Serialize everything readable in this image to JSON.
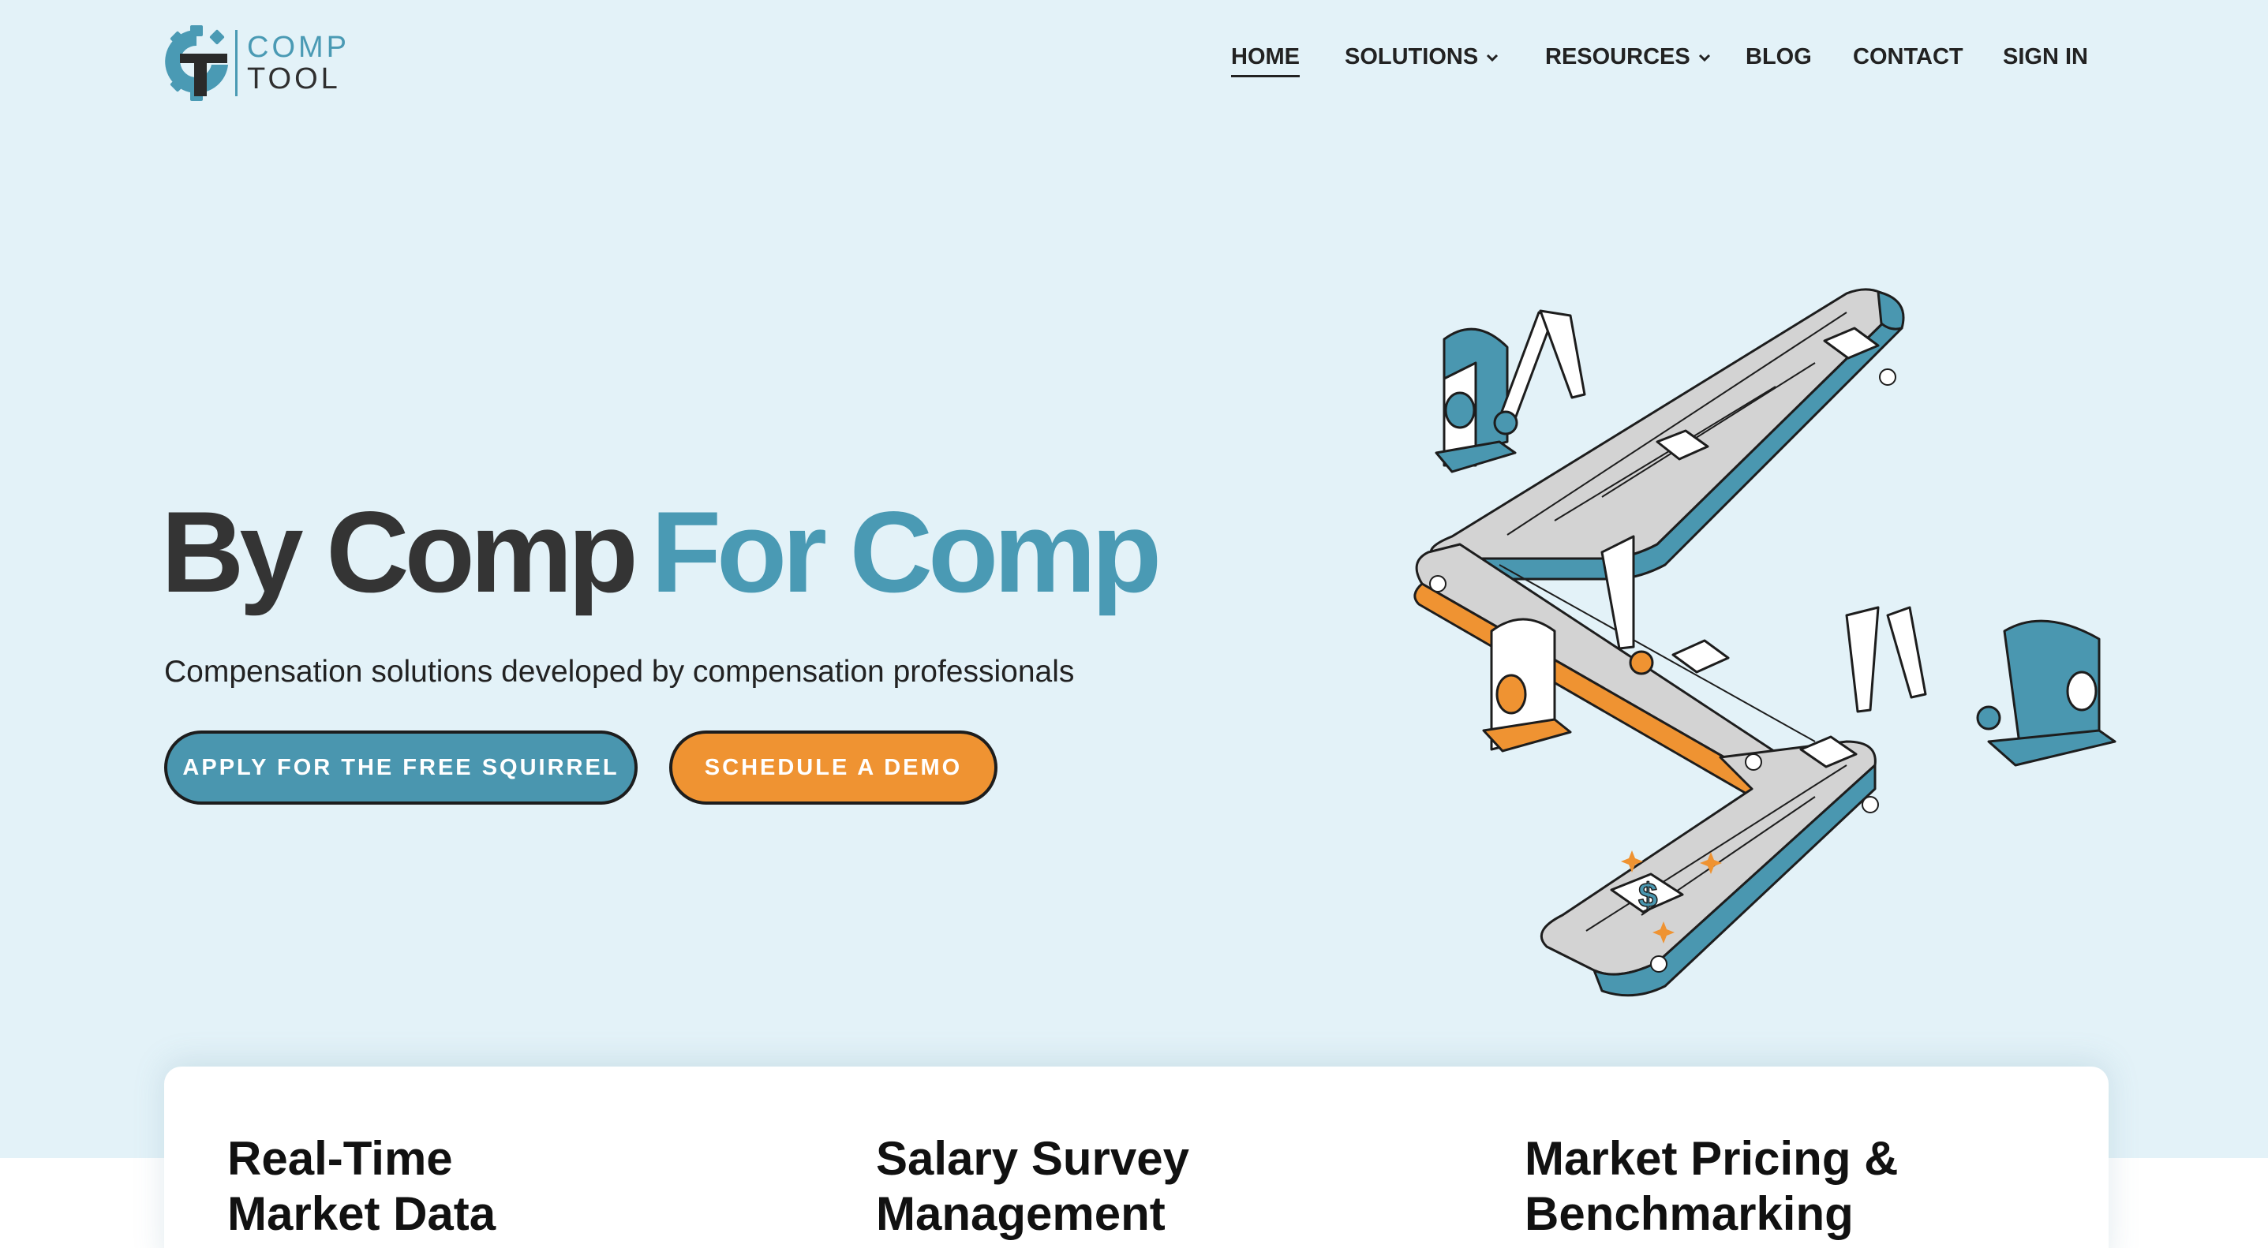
{
  "brand": {
    "logo_line_1": "COMP",
    "logo_line_2": "TOOL",
    "logo_icon": "gear-t-logo-icon",
    "colors": {
      "teal": "#4a9ab4",
      "orange": "#ef9332",
      "dark": "#343434",
      "hero_bg": "#e3f2f8"
    }
  },
  "nav": {
    "items": [
      {
        "label": "HOME",
        "active": true
      },
      {
        "label": "SOLUTIONS",
        "has_dropdown": true
      },
      {
        "label": "RESOURCES",
        "has_dropdown": true
      },
      {
        "label": "BLOG"
      },
      {
        "label": "CONTACT"
      },
      {
        "label": "SIGN IN"
      }
    ]
  },
  "hero": {
    "title_part_1": "By Comp",
    "title_part_2": "For Comp",
    "subtitle": "Compensation solutions developed by compensation professionals",
    "primary_button": "APPLY FOR THE FREE SQUIRREL",
    "secondary_button": "SCHEDULE A DEMO",
    "illustration": "isometric-conveyor-belt-robot-arms-illustration"
  },
  "features": [
    {
      "title_line_1": "Real-Time",
      "title_line_2": "Market Data"
    },
    {
      "title_line_1": "Salary Survey",
      "title_line_2": "Management"
    },
    {
      "title_line_1": "Market Pricing &",
      "title_line_2": "Benchmarking"
    }
  ]
}
